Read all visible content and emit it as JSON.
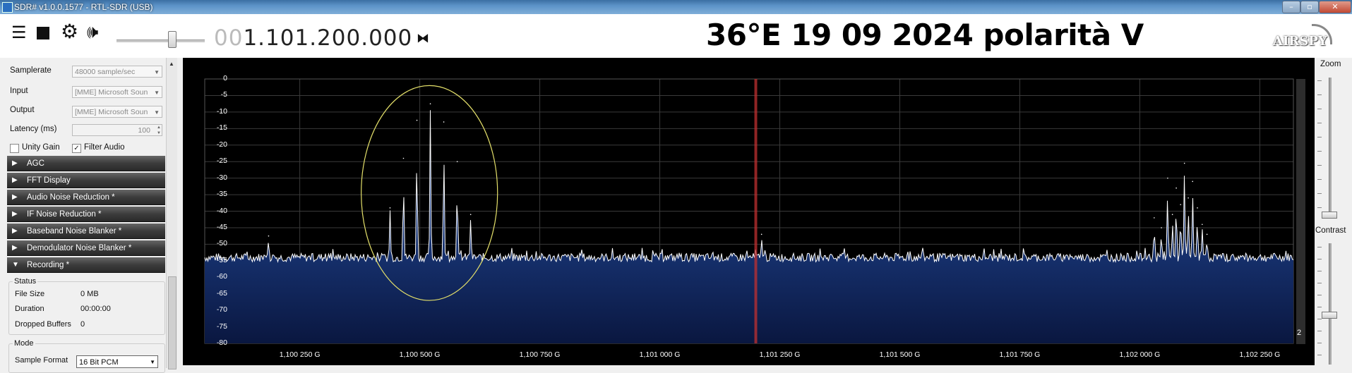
{
  "window": {
    "title": "SDR# v1.0.0.1577 - RTL-SDR (USB)"
  },
  "toolbar": {
    "frequency_dim": "00",
    "frequency_main": "1.101.200.000",
    "overlay_title": "36°E 19 09 2024 polarità V",
    "logo": "AIRSPY",
    "volume_level": 0.62
  },
  "audio": {
    "samplerate_label": "Samplerate",
    "samplerate_value": "48000 sample/sec",
    "input_label": "Input",
    "input_value": "[MME] Microsoft Soun",
    "output_label": "Output",
    "output_value": "[MME] Microsoft Soun",
    "latency_label": "Latency (ms)",
    "latency_value": "100",
    "unity_gain_label": "Unity Gain",
    "unity_gain_checked": false,
    "filter_audio_label": "Filter Audio",
    "filter_audio_checked": true
  },
  "panels": [
    {
      "label": "AGC",
      "expanded": false
    },
    {
      "label": "FFT Display",
      "expanded": false
    },
    {
      "label": "Audio Noise Reduction *",
      "expanded": false
    },
    {
      "label": "IF Noise Reduction *",
      "expanded": false
    },
    {
      "label": "Baseband Noise Blanker *",
      "expanded": false
    },
    {
      "label": "Demodulator Noise Blanker *",
      "expanded": false
    },
    {
      "label": "Recording *",
      "expanded": true
    }
  ],
  "recording": {
    "status_legend": "Status",
    "file_size_label": "File Size",
    "file_size_value": "0 MB",
    "duration_label": "Duration",
    "duration_value": "00:00:00",
    "dropped_label": "Dropped Buffers",
    "dropped_value": "0",
    "mode_legend": "Mode",
    "sample_format_label": "Sample Format",
    "sample_format_value": "16 Bit PCM"
  },
  "right_panel": {
    "zoom_label": "Zoom",
    "contrast_label": "Contrast",
    "zoom_level": 0.0,
    "contrast_level": 0.0,
    "range_value": "2"
  },
  "colors": {
    "spectrum_bg": "#000000",
    "trace": "#ffffff",
    "fill": "#1e3f8a",
    "center_marker": "#c03030",
    "annotation": "#e4e06a"
  },
  "chart_data": {
    "type": "area",
    "yticks": [
      "0",
      "-5",
      "-10",
      "-15",
      "-20",
      "-25",
      "-30",
      "-35",
      "-40",
      "-45",
      "-50",
      "-55",
      "-60",
      "-65",
      "-70",
      "-75",
      "-80"
    ],
    "xticks": [
      "1,100 250 G",
      "1,100 500 G",
      "1,100 750 G",
      "1,101 000 G",
      "1,101 250 G",
      "1,101 500 G",
      "1,101 750 G",
      "1,102 000 G",
      "1,102 250 G"
    ],
    "xtick_values": [
      1100250,
      1100500,
      1100750,
      1101000,
      1101250,
      1101500,
      1101750,
      1102000,
      1102250
    ],
    "xlim": [
      1100052,
      1102320
    ],
    "ylim": [
      -80,
      0
    ],
    "noise_floor": -54,
    "center_frequency": 1101200,
    "grid": true,
    "peaks": [
      {
        "x": 1100185,
        "y": -47.5
      },
      {
        "x": 1100438,
        "y": -39
      },
      {
        "x": 1100466,
        "y": -24
      },
      {
        "x": 1100494,
        "y": -12.5
      },
      {
        "x": 1100522,
        "y": -7.5
      },
      {
        "x": 1100550,
        "y": -13
      },
      {
        "x": 1100578,
        "y": -25
      },
      {
        "x": 1100606,
        "y": -41
      },
      {
        "x": 1101212,
        "y": -47
      },
      {
        "x": 1102030,
        "y": -42
      },
      {
        "x": 1102045,
        "y": -45
      },
      {
        "x": 1102058,
        "y": -30
      },
      {
        "x": 1102068,
        "y": -41
      },
      {
        "x": 1102076,
        "y": -33
      },
      {
        "x": 1102085,
        "y": -38
      },
      {
        "x": 1102093,
        "y": -25.5
      },
      {
        "x": 1102101,
        "y": -36
      },
      {
        "x": 1102110,
        "y": -31
      },
      {
        "x": 1102120,
        "y": -39
      },
      {
        "x": 1102130,
        "y": -44
      },
      {
        "x": 1102140,
        "y": -47
      }
    ],
    "annotation_ellipse": {
      "cx": 1100520,
      "cy": -34.5,
      "rx": 142,
      "ry": 32.5
    }
  }
}
